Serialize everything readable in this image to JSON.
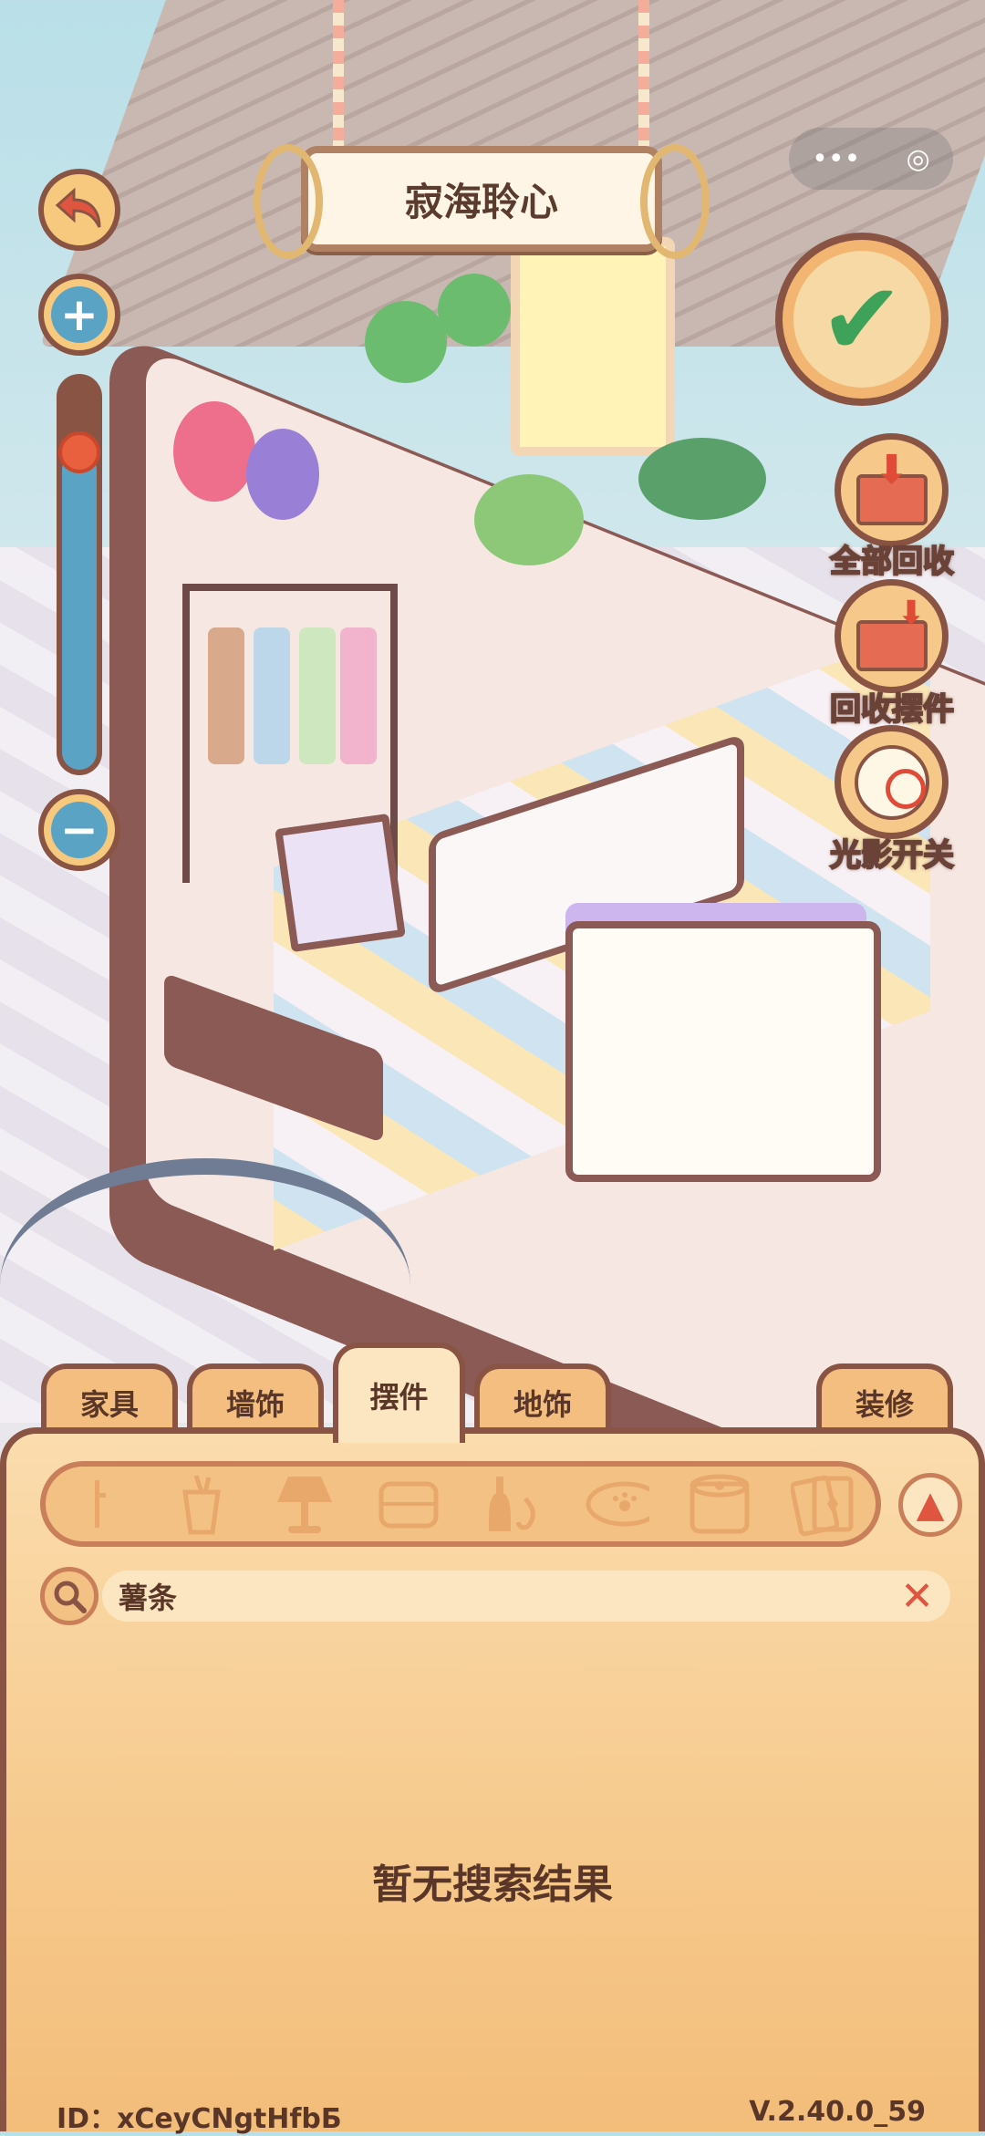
{
  "title": "寂海聆心",
  "capsule": {
    "more_icon": "•••",
    "close_icon": "◎"
  },
  "controls": {
    "undo_icon": "undo-arrow",
    "zoom_in_icon": "+",
    "zoom_out_icon": "−",
    "zoom_level": 0.85
  },
  "actions": {
    "confirm_icon": "✔",
    "recycle_all_label": "全部回收",
    "recycle_item_label": "回收摆件",
    "light_toggle_label": "光影开关"
  },
  "tabs": [
    {
      "label": "家具",
      "active": false
    },
    {
      "label": "墙饰",
      "active": false
    },
    {
      "label": "摆件",
      "active": true
    },
    {
      "label": "地饰",
      "active": false
    },
    {
      "label": "装修",
      "active": false
    }
  ],
  "categories": [
    "pin",
    "cup",
    "lamp",
    "pillow",
    "bottles",
    "pet-bowl",
    "tissue",
    "cards"
  ],
  "search": {
    "value": "薯条"
  },
  "empty_message": "暂无搜索结果",
  "footer": {
    "id": "ID：xCeyCNgtHfbБ",
    "version": "V.2.40.0_59"
  }
}
